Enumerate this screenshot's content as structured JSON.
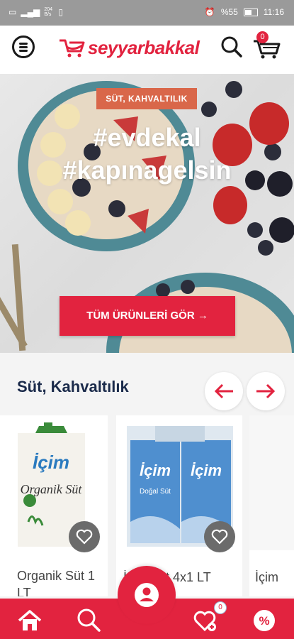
{
  "statusbar": {
    "battery": "%55",
    "time": "11:16",
    "net": "204 B/s"
  },
  "header": {
    "brand": "seyyarbakkal",
    "cart_count": "0"
  },
  "hero": {
    "category_tag": "SÜT, KAHVALTILIK",
    "hashtag_line1": "#evdekal",
    "hashtag_line2": "#kapınagelsin",
    "cta_label": "TÜM ÜRÜNLERİ GÖR →"
  },
  "section": {
    "title": "Süt, Kahvaltılık",
    "prev_icon": "arrow-left-icon",
    "next_icon": "arrow-right-icon"
  },
  "products": [
    {
      "name": "Organik Süt 1 LT",
      "brand_mark": "İçim",
      "label": "Organik Süt"
    },
    {
      "name": "İçim Süt 4x1 LT",
      "brand_mark": "İçim",
      "label": "Doğal Süt"
    },
    {
      "name": "İçim"
    }
  ],
  "bottom_nav": {
    "items": [
      "home-icon",
      "search-icon",
      "profile-icon",
      "favorites-icon",
      "discount-icon"
    ],
    "favorites_count": "0"
  },
  "colors": {
    "brand": "#e2233f",
    "title": "#1a2a4a"
  }
}
